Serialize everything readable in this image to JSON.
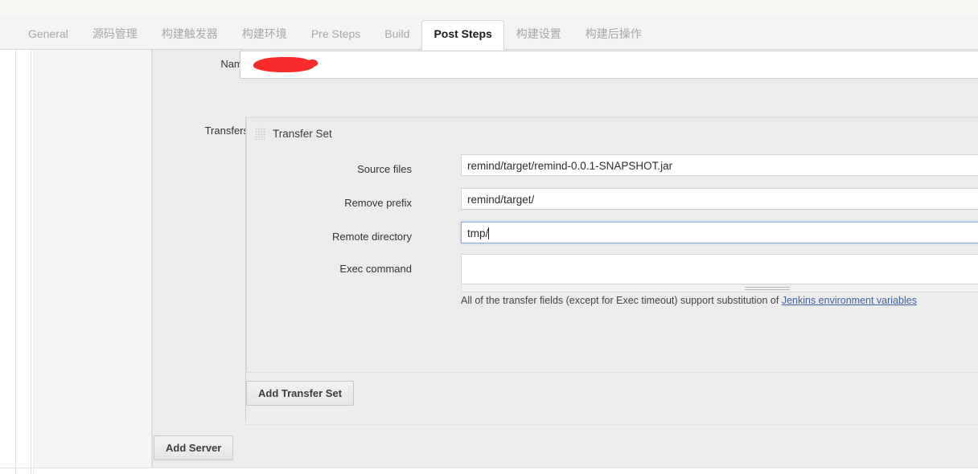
{
  "tabs": [
    {
      "label": "General",
      "active": false
    },
    {
      "label": "源码管理",
      "active": false
    },
    {
      "label": "构建触发器",
      "active": false
    },
    {
      "label": "构建环境",
      "active": false
    },
    {
      "label": "Pre Steps",
      "active": false
    },
    {
      "label": "Build",
      "active": false
    },
    {
      "label": "Post Steps",
      "active": true
    },
    {
      "label": "构建设置",
      "active": false
    },
    {
      "label": "构建后操作",
      "active": false
    }
  ],
  "form": {
    "name": {
      "label": "Name",
      "value": "",
      "redacted": true
    },
    "transfers": {
      "label": "Transfers",
      "transfer_set_title": "Transfer Set",
      "drag_handle_icon": "drag-grid-icon",
      "fields": [
        {
          "label": "Source files",
          "value": "remind/target/remind-0.0.1-SNAPSHOT.jar",
          "focused": false,
          "type": "text"
        },
        {
          "label": "Remove prefix",
          "value": "remind/target/",
          "focused": false,
          "type": "text"
        },
        {
          "label": "Remote directory",
          "value": "tmp/",
          "focused": true,
          "type": "text"
        },
        {
          "label": "Exec command",
          "value": "",
          "focused": false,
          "type": "textarea"
        }
      ],
      "helper_note_prefix": "All of the transfer fields (except for Exec timeout) support substitution of ",
      "helper_note_link": "Jenkins environment variables",
      "help_icon": "help-document-icon"
    },
    "buttons": {
      "add_transfer_set": "Add Transfer Set",
      "add_server": "Add Server"
    }
  },
  "colors": {
    "accent_focus": "#88b0d8",
    "redaction": "#fa2b2b",
    "link": "#3f5f9e",
    "panel_bg": "#ececec",
    "tab_inactive_text": "#a8a8a8"
  }
}
